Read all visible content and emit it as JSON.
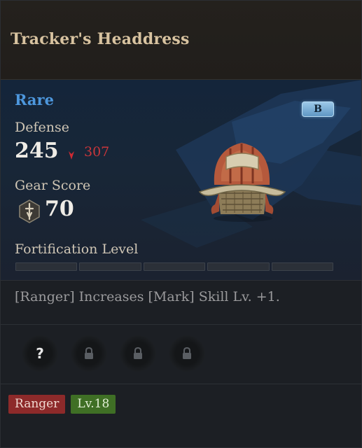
{
  "item": {
    "name": "Tracker's Headdress",
    "rarity": "Rare",
    "grade": "B",
    "defense_label": "Defense",
    "defense_value": "245",
    "defense_compare": "307",
    "gear_score_label": "Gear Score",
    "gear_score_value": "70",
    "fortification_label": "Fortification Level",
    "fortification": {
      "level": 0,
      "max": 5
    },
    "effect": "[Ranger] Increases [Mark] Skill Lv. +1.",
    "sockets": [
      {
        "state": "unknown",
        "glyph": "?"
      },
      {
        "state": "locked",
        "icon": "lock-icon"
      },
      {
        "state": "locked",
        "icon": "lock-icon"
      },
      {
        "state": "locked",
        "icon": "lock-icon"
      }
    ],
    "tags": {
      "class": "Ranger",
      "level": "Lv.18"
    }
  },
  "colors": {
    "rarity": "#4d97dd",
    "stat_decrease": "#c9363b",
    "class_tag": "#8d2a2a",
    "level_tag": "#3f6f25"
  }
}
